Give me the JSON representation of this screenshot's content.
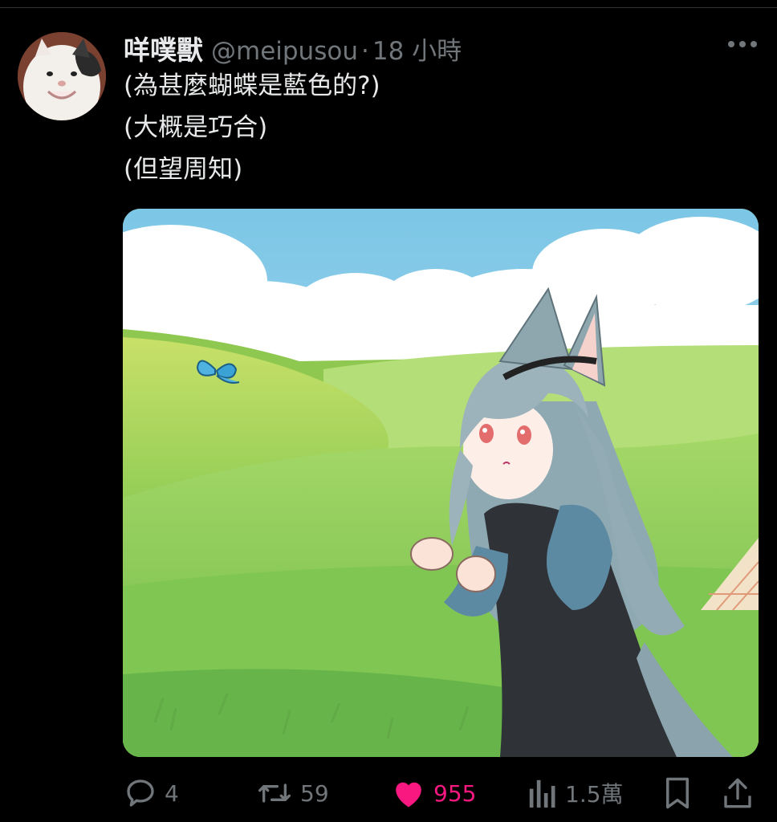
{
  "tweet": {
    "display_name": "咩噗獸",
    "handle": "@meipusou",
    "separator": "·",
    "time": "18 小時",
    "lines": [
      "(為甚麼蝴蝶是藍色的?)",
      "(大概是巧合)",
      "(但望周知)"
    ]
  },
  "actions": {
    "replies": "4",
    "retweets": "59",
    "likes": "955",
    "views": "1.5萬"
  },
  "colors": {
    "background": "#000000",
    "text": "#e7e9ea",
    "secondary": "#71767b",
    "like_active": "#f91880"
  },
  "icons": {
    "more": "more-horizontal-icon",
    "reply": "reply-bubble-icon",
    "retweet": "retweet-icon",
    "like": "heart-filled-icon",
    "views": "views-bar-chart-icon",
    "bookmark": "bookmark-icon",
    "share": "share-upload-icon"
  }
}
